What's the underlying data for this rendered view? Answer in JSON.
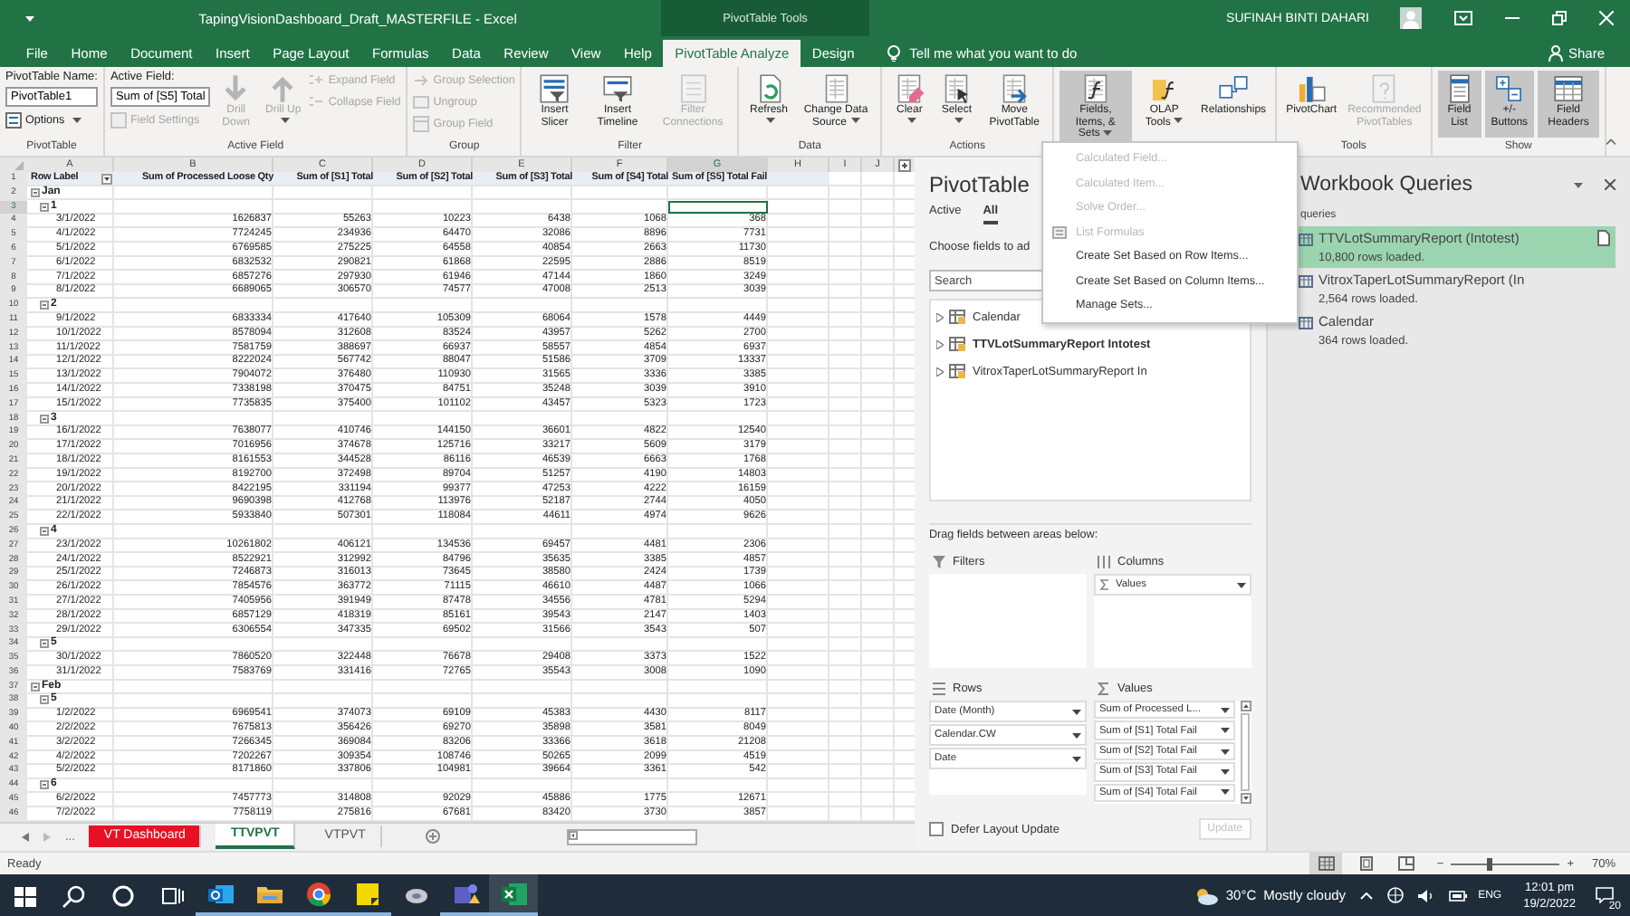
{
  "title_bar": {
    "title": "TapingVisionDashboard_Draft_MASTERFILE  -  Excel",
    "contextual_label": "PivotTable Tools",
    "user": "SUFINAH BINTI DAHARI"
  },
  "ribbon_tabs": {
    "tabs": [
      {
        "label": "File",
        "selected": false
      },
      {
        "label": "Home",
        "selected": false
      },
      {
        "label": "Document",
        "selected": false
      },
      {
        "label": "Insert",
        "selected": false
      },
      {
        "label": "Page Layout",
        "selected": false
      },
      {
        "label": "Formulas",
        "selected": false
      },
      {
        "label": "Data",
        "selected": false
      },
      {
        "label": "Review",
        "selected": false
      },
      {
        "label": "View",
        "selected": false
      },
      {
        "label": "Help",
        "selected": false
      },
      {
        "label": "PivotTable Analyze",
        "selected": true
      },
      {
        "label": "Design",
        "selected": false
      }
    ],
    "tell_me": "Tell me what you want to do",
    "share": "Share"
  },
  "ribbon": {
    "groups": [
      {
        "label": "PivotTable",
        "columns": [
          [
            {
              "kind": "caption",
              "label": "PivotTable Name:"
            },
            {
              "kind": "field",
              "value": "PivotTable1"
            },
            {
              "kind": "small",
              "label": "Options",
              "disabled": false,
              "dropdown": true
            }
          ]
        ]
      },
      {
        "label": "Active Field",
        "columns": [
          [
            {
              "kind": "caption",
              "label": "Active Field:"
            },
            {
              "kind": "field",
              "value": "Sum of [S5] Total"
            },
            {
              "kind": "small",
              "label": "Field Settings",
              "disabled": true,
              "dropdown": false
            }
          ],
          [
            {
              "kind": "large",
              "label": "Drill Down",
              "disabled": true,
              "pressed": false,
              "dropdown": false
            }
          ],
          [
            {
              "kind": "large",
              "label": "Drill Up",
              "disabled": true,
              "pressed": false,
              "dropdown": true
            }
          ],
          [
            {
              "kind": "small",
              "label": "Expand Field",
              "disabled": true,
              "dropdown": false
            },
            {
              "kind": "small",
              "label": "Collapse Field",
              "disabled": true,
              "dropdown": false
            }
          ]
        ]
      },
      {
        "label": "Group",
        "columns": [
          [
            {
              "kind": "small",
              "label": "Group Selection",
              "disabled": true,
              "dropdown": false
            },
            {
              "kind": "small",
              "label": "Ungroup",
              "disabled": true,
              "dropdown": false
            },
            {
              "kind": "small",
              "label": "Group Field",
              "disabled": true,
              "dropdown": false
            }
          ]
        ]
      },
      {
        "label": "Filter",
        "columns": [
          [
            {
              "kind": "large",
              "label": "Insert Slicer",
              "disabled": false,
              "pressed": false,
              "dropdown": false
            }
          ],
          [
            {
              "kind": "large",
              "label": "Insert Timeline",
              "disabled": false,
              "pressed": false,
              "dropdown": false
            }
          ],
          [
            {
              "kind": "large",
              "label": "Filter Connections",
              "disabled": true,
              "pressed": false,
              "dropdown": false
            }
          ]
        ]
      },
      {
        "label": "Data",
        "columns": [
          [
            {
              "kind": "large",
              "label": "Refresh",
              "disabled": false,
              "pressed": false,
              "dropdown": true
            }
          ],
          [
            {
              "kind": "large",
              "label": "Change Data Source",
              "disabled": false,
              "pressed": false,
              "dropdown": true
            }
          ]
        ]
      },
      {
        "label": "Actions",
        "columns": [
          [
            {
              "kind": "large",
              "label": "Clear",
              "disabled": false,
              "pressed": false,
              "dropdown": true
            }
          ],
          [
            {
              "kind": "large",
              "label": "Select",
              "disabled": false,
              "pressed": false,
              "dropdown": true
            }
          ],
          [
            {
              "kind": "large",
              "label": "Move PivotTable",
              "disabled": false,
              "pressed": false,
              "dropdown": false
            }
          ]
        ]
      },
      {
        "columns": [
          [
            {
              "kind": "large",
              "label": "Fields, Items, & Sets",
              "disabled": false,
              "pressed": true,
              "dropdown": true
            }
          ],
          [
            {
              "kind": "large",
              "label": "OLAP Tools",
              "disabled": false,
              "pressed": false,
              "dropdown": true
            }
          ],
          [
            {
              "kind": "large",
              "label": "Relationships",
              "disabled": false,
              "pressed": false,
              "dropdown": false
            }
          ]
        ]
      },
      {
        "label": "Tools",
        "columns": [
          [
            {
              "kind": "large",
              "label": "PivotChart",
              "disabled": false,
              "pressed": false,
              "dropdown": false
            }
          ],
          [
            {
              "kind": "large",
              "label": "Recommended PivotTables",
              "disabled": true,
              "pressed": false,
              "dropdown": false
            }
          ]
        ]
      },
      {
        "label": "Show",
        "columns": [
          [
            {
              "kind": "large",
              "label": "Field List",
              "disabled": false,
              "pressed": true,
              "dropdown": false
            }
          ],
          [
            {
              "kind": "large",
              "label": "+/- Buttons",
              "disabled": false,
              "pressed": true,
              "dropdown": false
            }
          ],
          [
            {
              "kind": "large",
              "label": "Field Headers",
              "disabled": false,
              "pressed": true,
              "dropdown": false
            }
          ]
        ]
      }
    ]
  },
  "menu": {
    "items": [
      {
        "label": "Calculated Field...",
        "disabled": true,
        "kind": "plain"
      },
      {
        "label": "Calculated Item...",
        "disabled": true,
        "kind": "plain"
      },
      {
        "label": "Solve Order...",
        "disabled": true,
        "kind": "plain"
      },
      {
        "label": "List Formulas",
        "disabled": true,
        "kind": "icon"
      },
      {
        "label": "Create Set Based on Row Items...",
        "disabled": false,
        "kind": "plain"
      },
      {
        "label": "Create Set Based on Column Items...",
        "disabled": false,
        "kind": "plain"
      },
      {
        "label": "Manage Sets...",
        "disabled": false,
        "kind": "plain"
      }
    ]
  },
  "grid": {
    "columns": [
      {
        "label": "A",
        "selected": false
      },
      {
        "label": "B",
        "selected": false
      },
      {
        "label": "C",
        "selected": false
      },
      {
        "label": "D",
        "selected": false
      },
      {
        "label": "E",
        "selected": false
      },
      {
        "label": "F",
        "selected": false
      },
      {
        "label": "G",
        "selected": true
      },
      {
        "label": "H",
        "selected": false
      },
      {
        "label": "I",
        "selected": false
      },
      {
        "label": "J",
        "selected": false
      }
    ],
    "header": {
      "number": "1",
      "selected": false,
      "cells": [
        "Row Label",
        "Sum of Processed Loose Qty",
        "Sum of [S1] Total",
        "Sum of [S2] Total",
        "Sum of [S3] Total",
        "Sum of [S4] Total",
        "Sum of [S5] Total Fail"
      ]
    },
    "rows": [
      {
        "number": "2",
        "label": "Jan",
        "selected": false,
        "expanded": true,
        "children": [
          {
            "number": "3",
            "label": "1",
            "selected": true,
            "expanded": true,
            "children": [
              {
                "number": "4",
                "label": "3/1/2022",
                "selected": false,
                "values": [
                  "1626837",
                  "55263",
                  "10223",
                  "6438",
                  "1068",
                  "368"
                ]
              },
              {
                "number": "5",
                "label": "4/1/2022",
                "selected": false,
                "values": [
                  "7724245",
                  "234936",
                  "64470",
                  "32086",
                  "8896",
                  "7731"
                ]
              },
              {
                "number": "6",
                "label": "5/1/2022",
                "selected": false,
                "values": [
                  "6769585",
                  "275225",
                  "64558",
                  "40854",
                  "2663",
                  "11730"
                ]
              },
              {
                "number": "7",
                "label": "6/1/2022",
                "selected": false,
                "values": [
                  "6832532",
                  "290821",
                  "61868",
                  "22595",
                  "2886",
                  "8519"
                ]
              },
              {
                "number": "8",
                "label": "7/1/2022",
                "selected": false,
                "values": [
                  "6857276",
                  "297930",
                  "61946",
                  "47144",
                  "1860",
                  "3249"
                ]
              },
              {
                "number": "9",
                "label": "8/1/2022",
                "selected": false,
                "values": [
                  "6689065",
                  "306570",
                  "74577",
                  "47008",
                  "2513",
                  "3039"
                ]
              }
            ]
          },
          {
            "number": "10",
            "label": "2",
            "selected": false,
            "expanded": true,
            "children": [
              {
                "number": "11",
                "label": "9/1/2022",
                "selected": false,
                "values": [
                  "6833334",
                  "417640",
                  "105309",
                  "68064",
                  "1578",
                  "4449"
                ]
              },
              {
                "number": "12",
                "label": "10/1/2022",
                "selected": false,
                "values": [
                  "8578094",
                  "312608",
                  "83524",
                  "43957",
                  "5262",
                  "2700"
                ]
              },
              {
                "number": "13",
                "label": "11/1/2022",
                "selected": false,
                "values": [
                  "7581759",
                  "388697",
                  "66937",
                  "58557",
                  "4854",
                  "6937"
                ]
              },
              {
                "number": "14",
                "label": "12/1/2022",
                "selected": false,
                "values": [
                  "8222024",
                  "567742",
                  "88047",
                  "51586",
                  "3709",
                  "13337"
                ]
              },
              {
                "number": "15",
                "label": "13/1/2022",
                "selected": false,
                "values": [
                  "7904072",
                  "376480",
                  "110930",
                  "31565",
                  "3336",
                  "3385"
                ]
              },
              {
                "number": "16",
                "label": "14/1/2022",
                "selected": false,
                "values": [
                  "7338198",
                  "370475",
                  "84751",
                  "35248",
                  "3039",
                  "3910"
                ]
              },
              {
                "number": "17",
                "label": "15/1/2022",
                "selected": false,
                "values": [
                  "7735835",
                  "375400",
                  "101102",
                  "43457",
                  "5323",
                  "1723"
                ]
              }
            ]
          },
          {
            "number": "18",
            "label": "3",
            "selected": false,
            "expanded": true,
            "children": [
              {
                "number": "19",
                "label": "16/1/2022",
                "selected": false,
                "values": [
                  "7638077",
                  "410746",
                  "144150",
                  "36601",
                  "4822",
                  "12540"
                ]
              },
              {
                "number": "20",
                "label": "17/1/2022",
                "selected": false,
                "values": [
                  "7016956",
                  "374678",
                  "125716",
                  "33217",
                  "5609",
                  "3179"
                ]
              },
              {
                "number": "21",
                "label": "18/1/2022",
                "selected": false,
                "values": [
                  "8161553",
                  "344528",
                  "86116",
                  "46539",
                  "6663",
                  "1768"
                ]
              },
              {
                "number": "22",
                "label": "19/1/2022",
                "selected": false,
                "values": [
                  "8192700",
                  "372498",
                  "89704",
                  "51257",
                  "4190",
                  "14803"
                ]
              },
              {
                "number": "23",
                "label": "20/1/2022",
                "selected": false,
                "values": [
                  "8422195",
                  "331194",
                  "99377",
                  "47253",
                  "4222",
                  "16159"
                ]
              },
              {
                "number": "24",
                "label": "21/1/2022",
                "selected": false,
                "values": [
                  "9690398",
                  "412768",
                  "113976",
                  "52187",
                  "2744",
                  "4050"
                ]
              },
              {
                "number": "25",
                "label": "22/1/2022",
                "selected": false,
                "values": [
                  "5933840",
                  "507301",
                  "118084",
                  "44611",
                  "4974",
                  "9626"
                ]
              }
            ]
          },
          {
            "number": "26",
            "label": "4",
            "selected": false,
            "expanded": true,
            "children": [
              {
                "number": "27",
                "label": "23/1/2022",
                "selected": false,
                "values": [
                  "10261802",
                  "406121",
                  "134536",
                  "69457",
                  "4481",
                  "2306"
                ]
              },
              {
                "number": "28",
                "label": "24/1/2022",
                "selected": false,
                "values": [
                  "8522921",
                  "312992",
                  "84796",
                  "35635",
                  "3385",
                  "4857"
                ]
              },
              {
                "number": "29",
                "label": "25/1/2022",
                "selected": false,
                "values": [
                  "7246873",
                  "316013",
                  "73645",
                  "38580",
                  "2424",
                  "1739"
                ]
              },
              {
                "number": "30",
                "label": "26/1/2022",
                "selected": false,
                "values": [
                  "7854576",
                  "363772",
                  "71115",
                  "46610",
                  "4487",
                  "1066"
                ]
              },
              {
                "number": "31",
                "label": "27/1/2022",
                "selected": false,
                "values": [
                  "7405956",
                  "391949",
                  "87478",
                  "34556",
                  "4781",
                  "5294"
                ]
              },
              {
                "number": "32",
                "label": "28/1/2022",
                "selected": false,
                "values": [
                  "6857129",
                  "418319",
                  "85161",
                  "39543",
                  "2147",
                  "1403"
                ]
              },
              {
                "number": "33",
                "label": "29/1/2022",
                "selected": false,
                "values": [
                  "6306554",
                  "347335",
                  "69502",
                  "31566",
                  "3543",
                  "507"
                ]
              }
            ]
          },
          {
            "number": "34",
            "label": "5",
            "selected": false,
            "expanded": true,
            "children": [
              {
                "number": "35",
                "label": "30/1/2022",
                "selected": false,
                "values": [
                  "7860520",
                  "322448",
                  "76678",
                  "29408",
                  "3373",
                  "1522"
                ]
              },
              {
                "number": "36",
                "label": "31/1/2022",
                "selected": false,
                "values": [
                  "7583769",
                  "331416",
                  "72765",
                  "35543",
                  "3008",
                  "1090"
                ]
              }
            ]
          }
        ]
      },
      {
        "number": "37",
        "label": "Feb",
        "selected": false,
        "expanded": true,
        "children": [
          {
            "number": "38",
            "label": "5",
            "selected": false,
            "expanded": true,
            "children": [
              {
                "number": "39",
                "label": "1/2/2022",
                "selected": false,
                "values": [
                  "6969541",
                  "374073",
                  "69109",
                  "45383",
                  "4430",
                  "8117"
                ]
              },
              {
                "number": "40",
                "label": "2/2/2022",
                "selected": false,
                "values": [
                  "7675813",
                  "356426",
                  "69270",
                  "35898",
                  "3581",
                  "8049"
                ]
              },
              {
                "number": "41",
                "label": "3/2/2022",
                "selected": false,
                "values": [
                  "7266345",
                  "369084",
                  "83206",
                  "33366",
                  "3618",
                  "21208"
                ]
              },
              {
                "number": "42",
                "label": "4/2/2022",
                "selected": false,
                "values": [
                  "7202267",
                  "309354",
                  "108746",
                  "50265",
                  "2099",
                  "4519"
                ]
              },
              {
                "number": "43",
                "label": "5/2/2022",
                "selected": false,
                "values": [
                  "8171860",
                  "337806",
                  "104981",
                  "39664",
                  "3361",
                  "542"
                ]
              }
            ]
          },
          {
            "number": "44",
            "label": "6",
            "selected": false,
            "expanded": true,
            "children": [
              {
                "number": "45",
                "label": "6/2/2022",
                "selected": false,
                "values": [
                  "7457773",
                  "314808",
                  "92029",
                  "45886",
                  "1775",
                  "12671"
                ]
              },
              {
                "number": "46",
                "label": "7/2/2022",
                "selected": false,
                "values": [
                  "7758119",
                  "275816",
                  "67681",
                  "83420",
                  "3730",
                  "3857"
                ]
              }
            ]
          }
        ]
      }
    ]
  },
  "sheet_tabs": {
    "more": "...",
    "tabs": [
      {
        "label": "VT Dashboard",
        "selected": false,
        "color": "#e81123"
      },
      {
        "label": "TTVPVT",
        "selected": true
      },
      {
        "label": "VTPVT",
        "selected": false
      }
    ]
  },
  "field_list": {
    "title": "PivotTable",
    "tabs": [
      {
        "label": "Active",
        "selected": false
      },
      {
        "label": "All",
        "selected": true
      }
    ],
    "prompt": "Choose fields to ad",
    "search": {
      "placeholder": "Search"
    },
    "tables": [
      {
        "label": "Calendar",
        "bold": false
      },
      {
        "label": "TTVLotSummaryReport  Intotest",
        "bold": true
      },
      {
        "label": "VitroxTaperLotSummaryReport  In",
        "bold": false
      }
    ],
    "areas_prompt": "Drag fields between areas below:",
    "areas": [
      {
        "kind": "filters",
        "title": "Filters"
      },
      {
        "kind": "columns",
        "title": "Columns",
        "items": [
          "Values"
        ]
      },
      {
        "kind": "rows",
        "title": "Rows",
        "items": [
          "Date (Month)",
          "Calendar.CW",
          "Date"
        ]
      },
      {
        "kind": "values",
        "title": "Values",
        "items": [
          "Sum of Processed L...",
          "Sum of [S1] Total Fail",
          "Sum of [S2] Total Fail",
          "Sum of [S3] Total Fail",
          "Sum of [S4] Total Fail"
        ]
      }
    ],
    "defer": {
      "label": "Defer Layout Update",
      "checked": false
    },
    "update": {
      "label": "Update",
      "disabled": true
    }
  },
  "queries": {
    "title": "Workbook Queries",
    "count_label": "queries",
    "items": [
      {
        "name": "TTVLotSummaryReport (Intotest)",
        "status": "10,800 rows loaded.",
        "selected": true
      },
      {
        "name": "VitroxTaperLotSummaryReport (In",
        "status": "2,564 rows loaded.",
        "selected": false
      },
      {
        "name": "Calendar",
        "status": "364 rows loaded.",
        "selected": false
      }
    ]
  },
  "status_bar": {
    "text": "Ready",
    "views": [
      {
        "selected": true
      },
      {
        "selected": false
      },
      {
        "selected": false
      }
    ],
    "zoom_out": "−",
    "zoom_in": "+",
    "zoom": {
      "level": 0.35,
      "reading": "70%"
    }
  },
  "taskbar": {
    "apps": [
      {
        "running": false,
        "selected": false
      },
      {
        "running": false,
        "selected": false
      },
      {
        "running": false,
        "selected": false
      },
      {
        "running": false,
        "selected": false
      },
      {
        "running": true,
        "selected": false
      },
      {
        "running": true,
        "selected": false
      },
      {
        "running": true,
        "selected": false
      },
      {
        "running": true,
        "selected": false
      },
      {
        "running": false,
        "selected": false
      },
      {
        "running": true,
        "selected": false
      },
      {
        "running": true,
        "selected": true
      }
    ],
    "temperature": "30°C",
    "weather": "Mostly cloudy",
    "language": "ENG",
    "time": "12:01 pm",
    "date": "19/2/2022",
    "notifications": "20"
  }
}
